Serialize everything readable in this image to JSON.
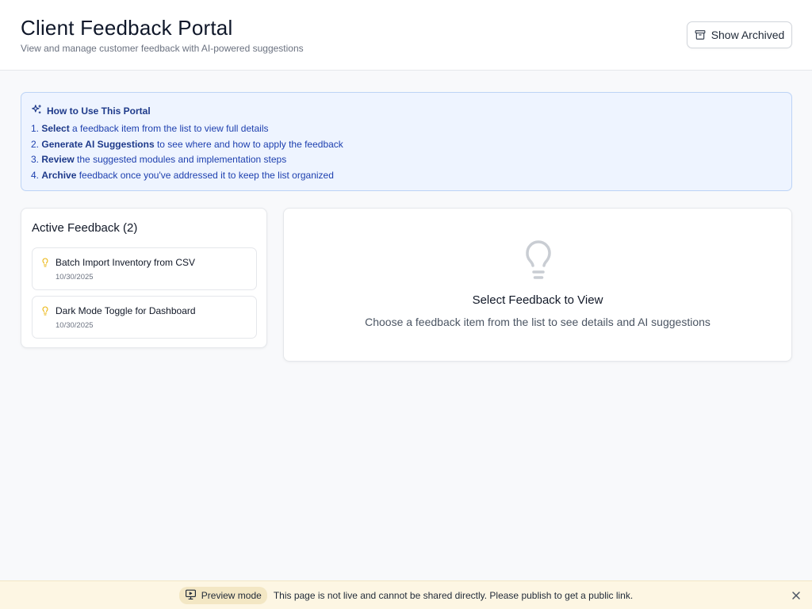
{
  "header": {
    "title": "Client Feedback Portal",
    "subtitle": "View and manage customer feedback with AI-powered suggestions",
    "archived_button_label": "Show Archived"
  },
  "how_to": {
    "title": "How to Use This Portal",
    "steps": [
      {
        "number": "1.",
        "bold": "Select",
        "rest": " a feedback item from the list to view full details"
      },
      {
        "number": "2.",
        "bold": "Generate AI Suggestions",
        "rest": " to see where and how to apply the feedback"
      },
      {
        "number": "3.",
        "bold": "Review",
        "rest": " the suggested modules and implementation steps"
      },
      {
        "number": "4.",
        "bold": "Archive",
        "rest": " feedback once you've addressed it to keep the list organized"
      }
    ]
  },
  "feedback_list": {
    "title": "Active Feedback (2)",
    "items": [
      {
        "title": "Batch Import Inventory from CSV",
        "date": "10/30/2025",
        "icon": "lightbulb-icon"
      },
      {
        "title": "Dark Mode Toggle for Dashboard",
        "date": "10/30/2025",
        "icon": "lightbulb-icon"
      }
    ]
  },
  "detail_panel": {
    "empty_title": "Select Feedback to View",
    "empty_description": "Choose a feedback item from the list to see details and AI suggestions",
    "icon": "lightbulb-icon"
  },
  "preview_banner": {
    "badge_label": "Preview mode",
    "message": "This page is not live and cannot be shared directly. Please publish to get a public link.",
    "icon": "monitor-icon"
  },
  "colors": {
    "accent_blue": "#1e40af",
    "howto_background": "#eef4ff",
    "lightbulb_yellow": "#eab308",
    "banner_background": "#fdf6e3"
  }
}
